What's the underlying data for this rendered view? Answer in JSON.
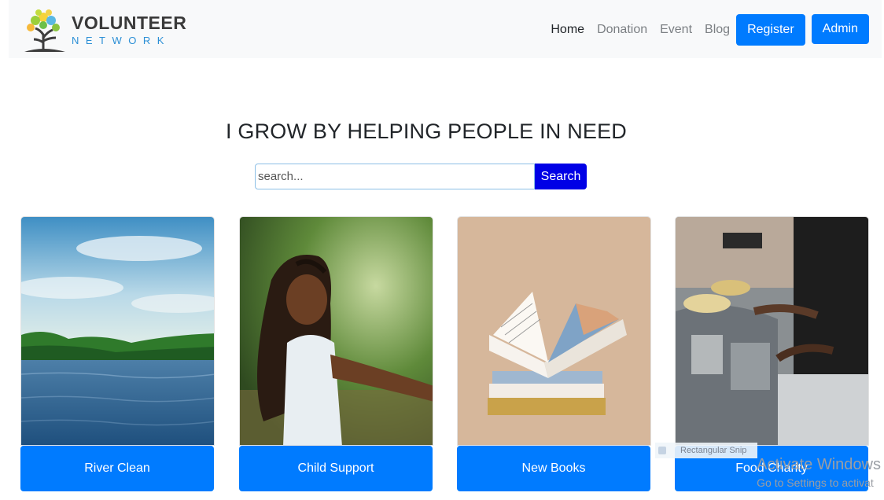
{
  "brand": {
    "name_line1": "VOLUNTEER",
    "name_line2": "NETWORK",
    "logo_icon": "tree-logo-icon"
  },
  "nav": {
    "links": [
      {
        "label": "Home",
        "active": true
      },
      {
        "label": "Donation",
        "active": false
      },
      {
        "label": "Event",
        "active": false
      },
      {
        "label": "Blog",
        "active": false
      }
    ],
    "register_label": "Register",
    "admin_label": "Admin"
  },
  "hero": {
    "headline": "I GROW BY HELPING PEOPLE IN NEED",
    "search_placeholder": "search...",
    "search_value": "",
    "search_button": "Search"
  },
  "events": [
    {
      "title": "River Clean",
      "image": "river-landscape-image"
    },
    {
      "title": "Child Support",
      "image": "smiling-girl-image"
    },
    {
      "title": "New Books",
      "image": "open-book-stack-image"
    },
    {
      "title": "Food Charity",
      "image": "food-donation-image"
    }
  ],
  "overlay": {
    "snip_label": "Rectangular Snip",
    "watermark_title": "Activate Windows",
    "watermark_sub": "Go to Settings to activat"
  },
  "colors": {
    "primary": "#007bff",
    "search_button": "#0000e6",
    "navbar_bg": "#f8f9fa"
  }
}
